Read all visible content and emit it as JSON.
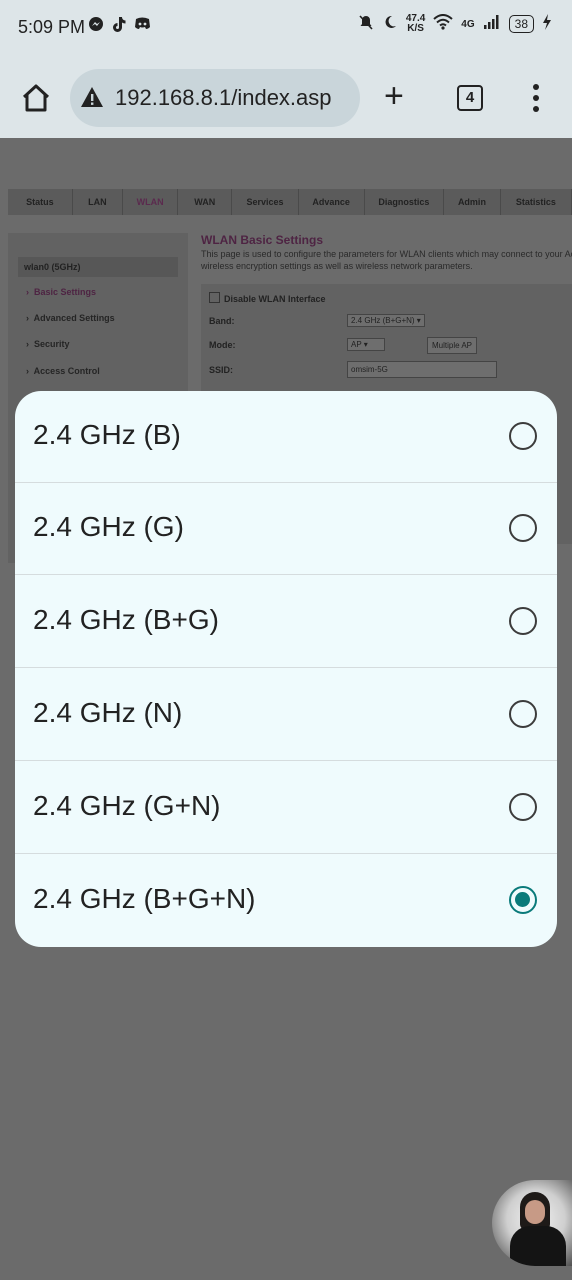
{
  "status_bar": {
    "time": "5:09 PM",
    "left_icons": [
      "messenger-icon",
      "tiktok-icon",
      "discord-icon"
    ],
    "net_speed_value": "47.4",
    "net_speed_unit": "K/S",
    "network_type": "4G",
    "battery": "38"
  },
  "browser": {
    "url": "192.168.8.1/index.asp",
    "tab_count": "4"
  },
  "router_page": {
    "nav_tabs": [
      "Status",
      "LAN",
      "WLAN",
      "WAN",
      "Services",
      "Advance",
      "Diagnostics",
      "Admin",
      "Statistics"
    ],
    "sidebar_header": "wlan0 (5GHz)",
    "sidebar_items": [
      "Basic Settings",
      "Advanced Settings",
      "Security",
      "Access Control"
    ],
    "title": "WLAN Basic Settings",
    "description_line1": "This page is used to configure the parameters for WLAN clients which may connect to your Access Point. Here you may change",
    "description_line2": "wireless encryption settings as well as wireless network parameters.",
    "disable_label": "Disable WLAN Interface",
    "band_label": "Band:",
    "band_value": "2.4 GHz (B+G+N)",
    "mode_label": "Mode:",
    "mode_value": "AP",
    "multiple_ap_label": "Multiple AP",
    "ssid_label": "SSID:",
    "ssid_value": "omsim-5G"
  },
  "dialog": {
    "options": [
      {
        "label": "2.4 GHz (B)",
        "selected": false
      },
      {
        "label": "2.4 GHz (G)",
        "selected": false
      },
      {
        "label": "2.4 GHz (B+G)",
        "selected": false
      },
      {
        "label": "2.4 GHz (N)",
        "selected": false
      },
      {
        "label": "2.4 GHz (G+N)",
        "selected": false
      },
      {
        "label": "2.4 GHz (B+G+N)",
        "selected": true
      }
    ]
  },
  "colors": {
    "accent": "#0a7a7a",
    "dialog_background": "#effbfd",
    "browser_bar": "#dde5e8",
    "scrim": "#6b6b6b"
  }
}
